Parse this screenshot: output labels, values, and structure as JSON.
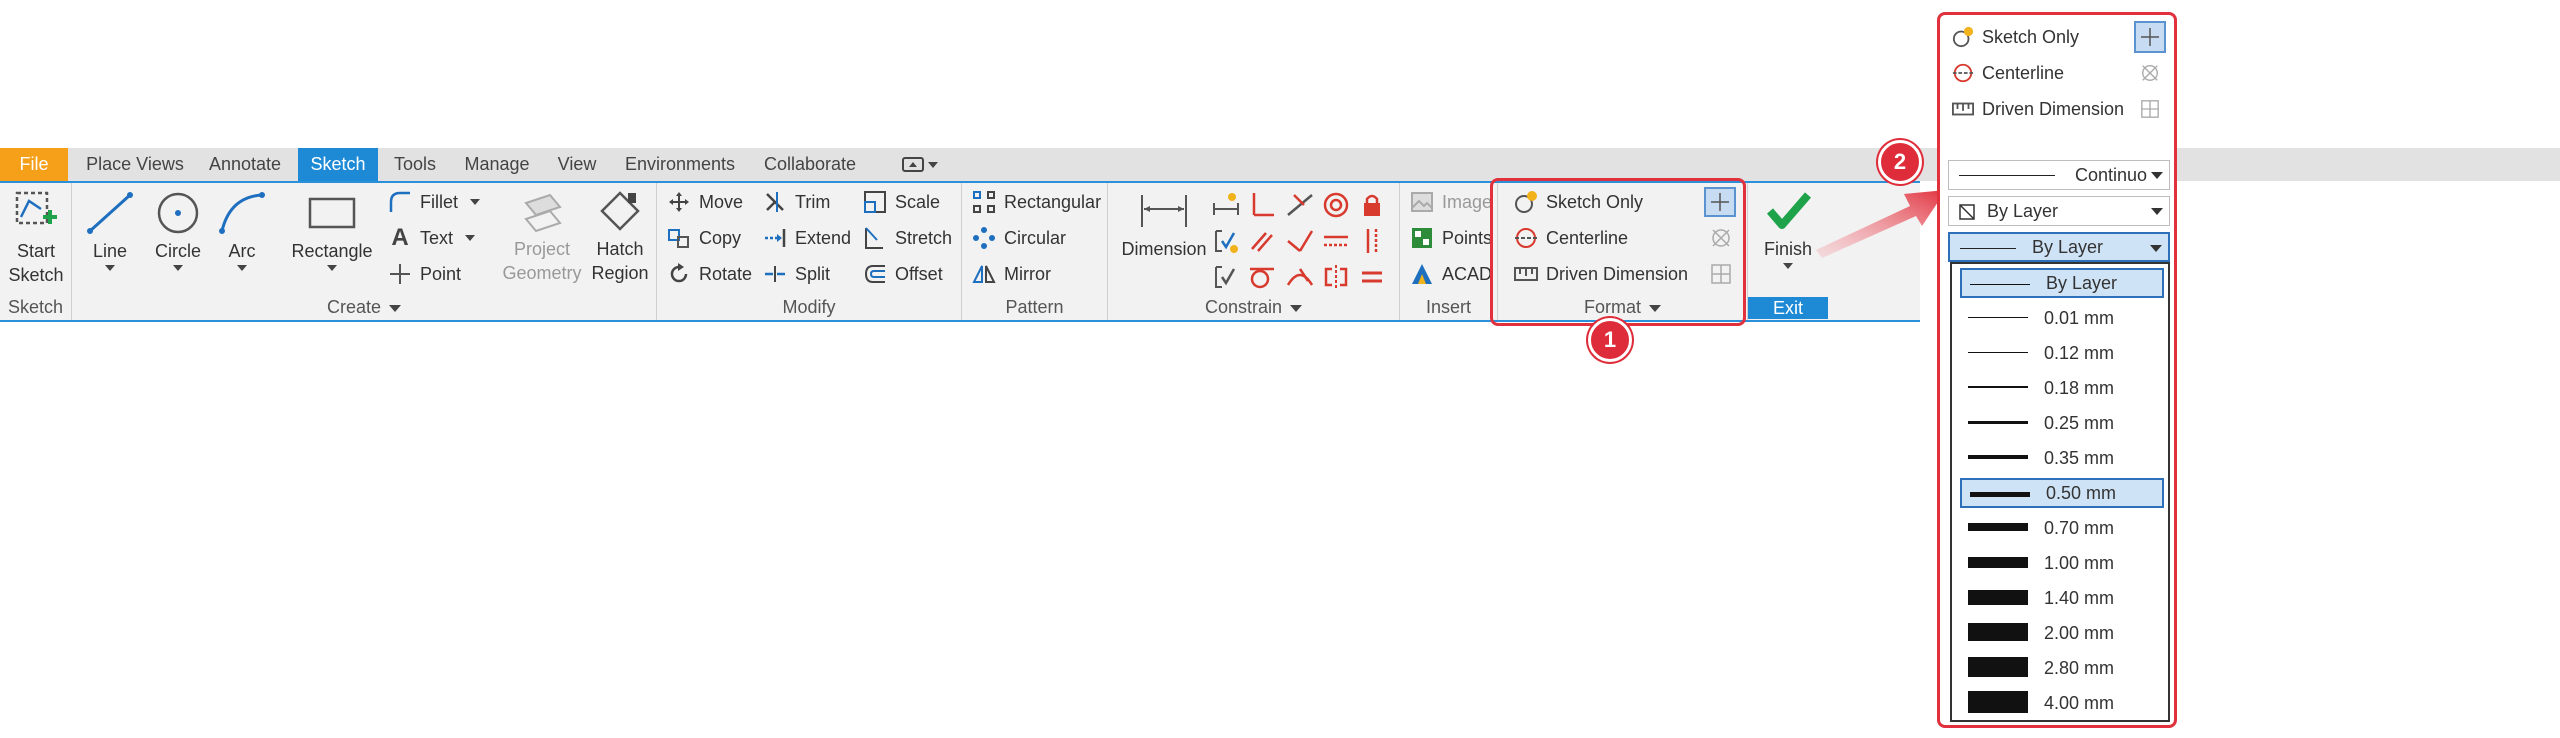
{
  "tabs": [
    "File",
    "Place Views",
    "Annotate",
    "Sketch",
    "Tools",
    "Manage",
    "View",
    "Environments",
    "Collaborate"
  ],
  "panels": {
    "sketch": {
      "title": "Sketch",
      "start_sketch": "Start\nSketch"
    },
    "create": {
      "title": "Create",
      "line": "Line",
      "circle": "Circle",
      "arc": "Arc",
      "rectangle": "Rectangle",
      "fillet": "Fillet",
      "text": "Text",
      "point": "Point",
      "project_geometry": "Project\nGeometry",
      "hatch_region": "Hatch\nRegion"
    },
    "modify": {
      "title": "Modify",
      "move": "Move",
      "copy": "Copy",
      "rotate": "Rotate",
      "trim": "Trim",
      "extend": "Extend",
      "split": "Split",
      "scale": "Scale",
      "stretch": "Stretch",
      "offset": "Offset"
    },
    "pattern": {
      "title": "Pattern",
      "rectangular": "Rectangular",
      "circular": "Circular",
      "mirror": "Mirror"
    },
    "constrain": {
      "title": "Constrain",
      "dimension": "Dimension"
    },
    "insert": {
      "title": "Insert",
      "image": "Image",
      "points": "Points",
      "acad": "ACAD"
    },
    "format": {
      "title": "Format",
      "sketch_only": "Sketch Only",
      "centerline": "Centerline",
      "driven_dimension": "Driven Dimension"
    },
    "exit": {
      "title": "Exit",
      "finish": "Finish"
    }
  },
  "callouts": {
    "one": "1",
    "two": "2"
  },
  "popup": {
    "sketch_only": "Sketch Only",
    "centerline": "Centerline",
    "driven_dimension": "Driven Dimension",
    "linetype": "Continuo",
    "color": "By Layer",
    "lineweight": "By Layer"
  },
  "lineweights": [
    {
      "label": "By Layer",
      "weight": 1
    },
    {
      "label": "0.01 mm",
      "weight": 1
    },
    {
      "label": "0.12 mm",
      "weight": 1
    },
    {
      "label": "0.18 mm",
      "weight": 2
    },
    {
      "label": "0.25 mm",
      "weight": 3
    },
    {
      "label": "0.35 mm",
      "weight": 4
    },
    {
      "label": "0.50 mm",
      "weight": 5
    },
    {
      "label": "0.70 mm",
      "weight": 8
    },
    {
      "label": "1.00 mm",
      "weight": 11
    },
    {
      "label": "1.40 mm",
      "weight": 15
    },
    {
      "label": "2.00 mm",
      "weight": 18
    },
    {
      "label": "2.80 mm",
      "weight": 20
    },
    {
      "label": "4.00 mm",
      "weight": 22
    }
  ],
  "colors": {
    "accent": "#1e8ad6",
    "file_tab": "#f6a01a",
    "highlight": "#e0313d",
    "check": "#1ea34a"
  }
}
